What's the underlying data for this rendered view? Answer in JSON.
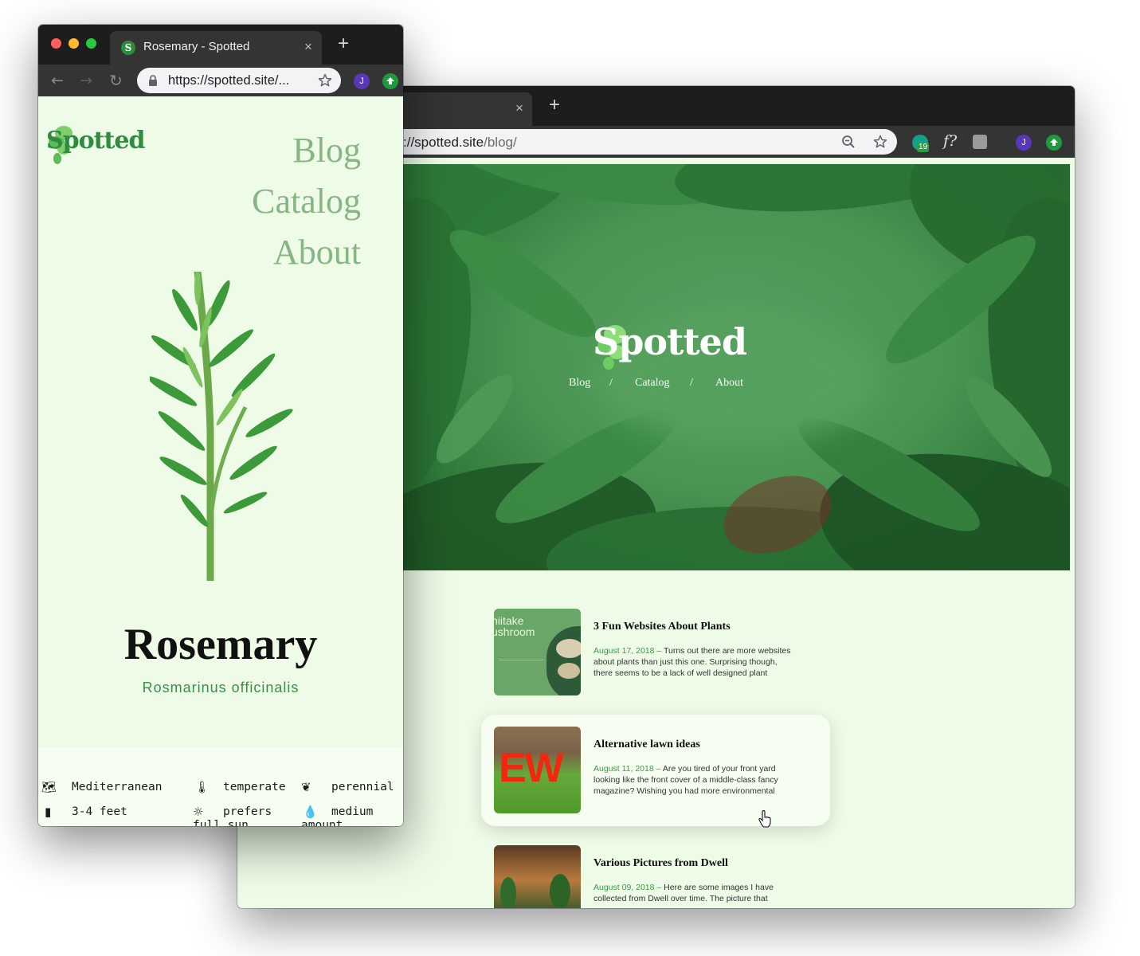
{
  "back_window": {
    "tab": {
      "close": "×"
    },
    "new_tab": "+",
    "url": {
      "prefix": "://spotted.site",
      "path": "/blog/"
    },
    "extensions": {
      "badge_count": "19",
      "fonts_label": "f?",
      "avatar": "J"
    },
    "hero": {
      "logo": "Spotted",
      "nav": [
        "Blog",
        "/",
        "Catalog",
        "/",
        "About"
      ]
    },
    "posts": [
      {
        "title": "3 Fun Websites About Plants",
        "date": "August 17, 2018",
        "sep": " – ",
        "excerpt": "Turns out there are more websites about plants than just this one. Surprising though, there seems to be a lack of well designed plant",
        "thumb_text": [
          "hiitake",
          "ushroom"
        ]
      },
      {
        "title": "Alternative lawn ideas",
        "date": "August 11, 2018",
        "sep": " – ",
        "excerpt": "Are you tired of your front yard looking like the front cover of a middle-class fancy magazine? Wishing you had more environmental",
        "thumb_text": [
          "EW"
        ]
      },
      {
        "title": "Various Pictures from Dwell",
        "date": "August 09, 2018",
        "sep": " – ",
        "excerpt": "Here are some images I have collected from Dwell over time. The picture that",
        "thumb_text": []
      }
    ]
  },
  "front_window": {
    "tab": {
      "title": "Rosemary - Spotted",
      "close": "×",
      "favicon": "S"
    },
    "new_tab": "+",
    "url": "https://spotted.site/...",
    "avatar": "J",
    "page": {
      "logo": "Spotted",
      "nav": [
        "Blog",
        "Catalog",
        "About"
      ],
      "plant_name": "Rosemary",
      "latin_name": "Rosmarinus officinalis",
      "attributes": [
        {
          "icon": "map-icon",
          "label": "Mediterranean"
        },
        {
          "icon": "thermometer-icon",
          "label": "temperate"
        },
        {
          "icon": "lotus-icon",
          "label": "perennial"
        },
        {
          "icon": "ruler-icon",
          "label": "3-4 feet"
        },
        {
          "icon": "sun-icon",
          "label": "prefers full sun"
        },
        {
          "icon": "drop-icon",
          "label": "medium amount"
        }
      ]
    }
  },
  "colors": {
    "brand_green": "#2e8b3f",
    "nav_green": "#87b584",
    "date_green": "#3d9a47",
    "page_bg": "#eefbe6",
    "chrome_dark": "#1d1d1d",
    "chrome_toolbar": "#343434"
  }
}
